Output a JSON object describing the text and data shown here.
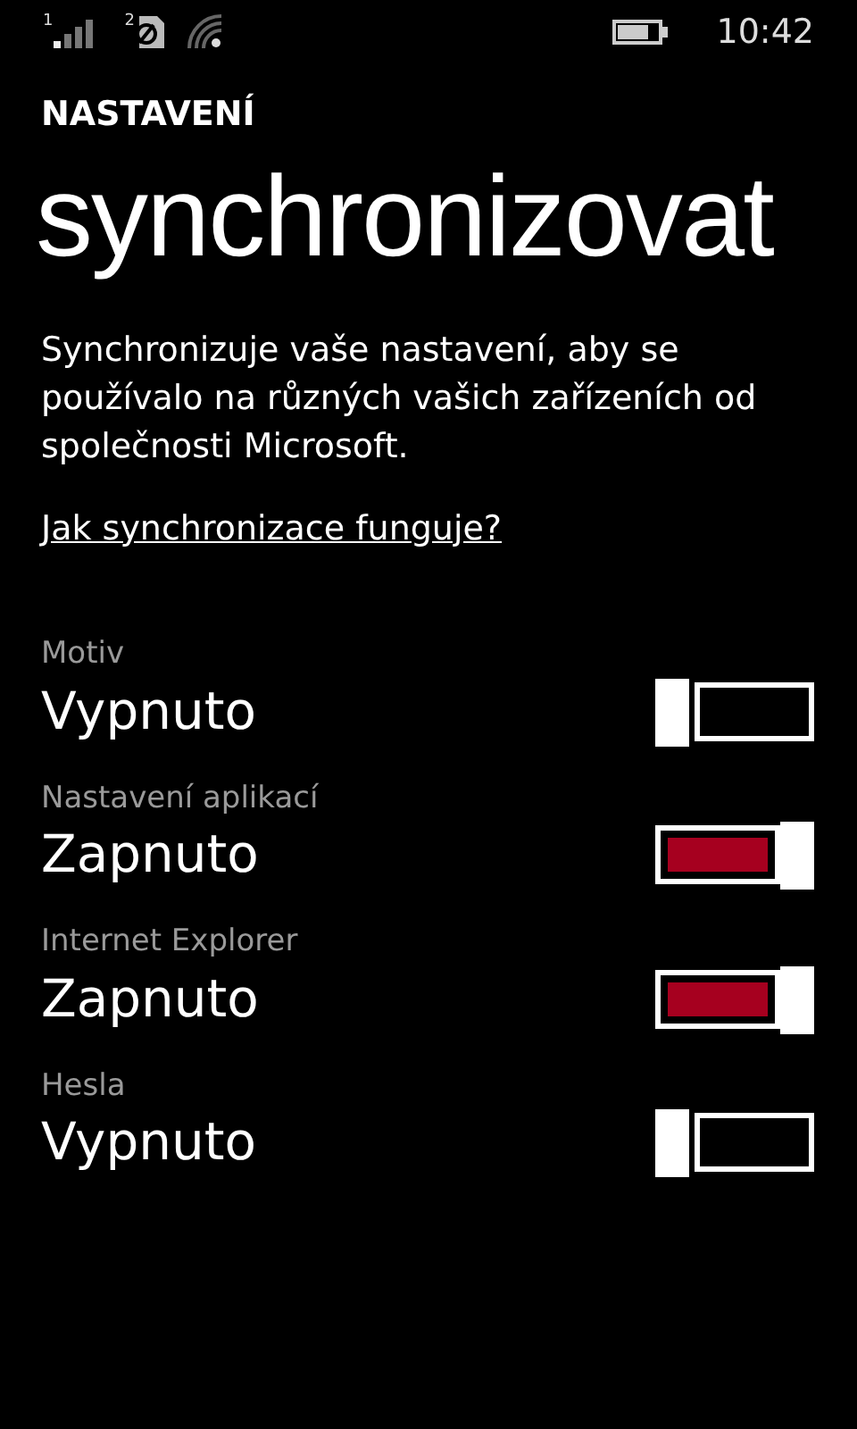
{
  "status_bar": {
    "sim_1": "1",
    "sim_2": "2",
    "time": "10:42"
  },
  "header": "NASTAVENÍ",
  "title": "synchronizovat",
  "description": "Synchronizuje vaše nastavení, aby se používalo na různých vašich zařízeních od společnosti Microsoft.",
  "help_link": "Jak synchronizace funguje?",
  "settings": [
    {
      "label": "Motiv",
      "value": "Vypnuto",
      "on": false
    },
    {
      "label": "Nastavení aplikací",
      "value": "Zapnuto",
      "on": true
    },
    {
      "label": "Internet Explorer",
      "value": "Zapnuto",
      "on": true
    },
    {
      "label": "Hesla",
      "value": "Vypnuto",
      "on": false
    }
  ]
}
